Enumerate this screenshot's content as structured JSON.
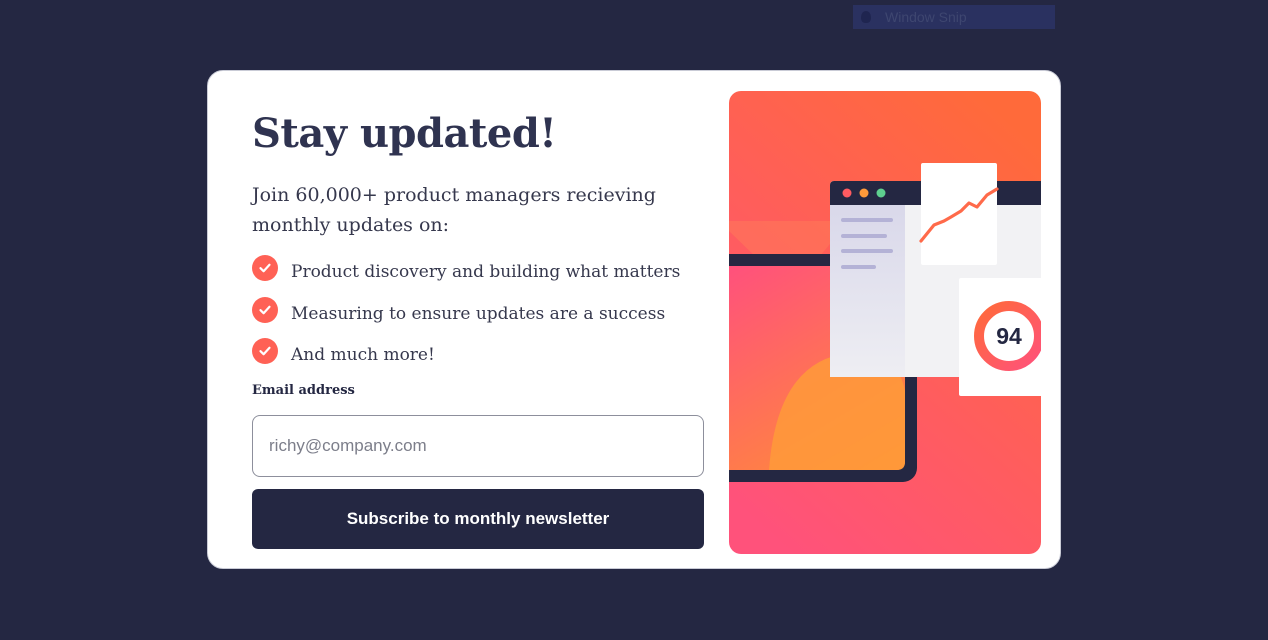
{
  "window_tag": {
    "label": "Window Snip",
    "icon": "pin-icon"
  },
  "newsletter": {
    "title": "Stay updated!",
    "intro": "Join 60,000+ product managers recieving monthly updates on:",
    "features": [
      {
        "icon": "check-icon",
        "text": "Product discovery and building what matters"
      },
      {
        "icon": "check-icon",
        "text": "Measuring to ensure updates are a success"
      },
      {
        "icon": "check-icon",
        "text": "And much more!"
      }
    ],
    "email_label": "Email address",
    "email_placeholder": "richy@company.com",
    "email_value": "",
    "subscribe_label": "Subscribe to monthly newsletter"
  },
  "illustration": {
    "score": "94",
    "colors": {
      "gradient_top": "#ff6a3a",
      "gradient_bottom": "#ff527b",
      "navy": "#242742",
      "accent": "#ff6155"
    }
  }
}
